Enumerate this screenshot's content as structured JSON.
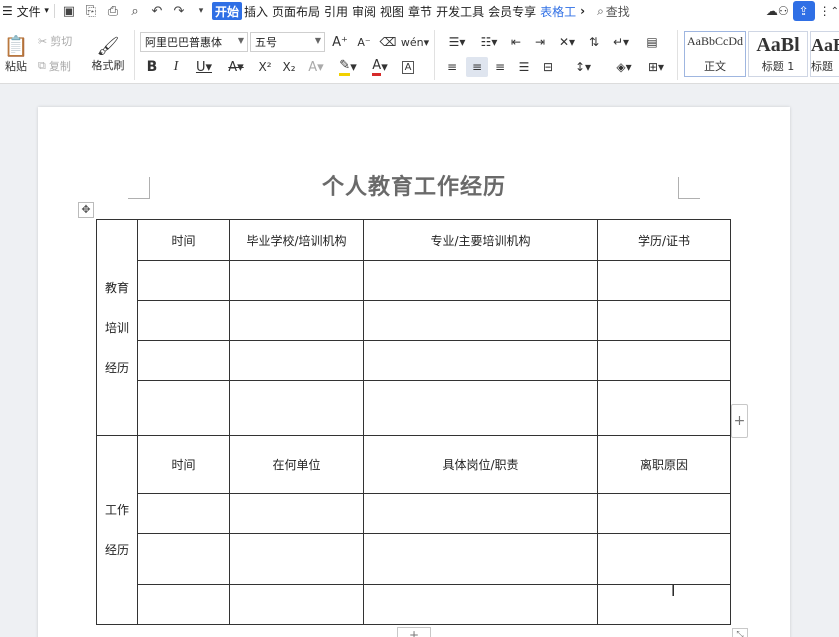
{
  "menubar": {
    "menu_label": "文件",
    "tabs": [
      "开始",
      "插入",
      "页面布局",
      "引用",
      "审阅",
      "视图",
      "章节",
      "开发工具",
      "会员专享",
      "表格工"
    ],
    "search_label": "查找",
    "more_tabs_glyph": "›"
  },
  "ribbon": {
    "paste_label": "粘贴",
    "cut_label": "剪切",
    "copy_label": "复制",
    "format_painter_label": "格式刷",
    "font_name": "阿里巴巴普惠体",
    "font_size": "五号",
    "styles": [
      {
        "preview": "AaBbCcDd",
        "label": "正文"
      },
      {
        "preview": "AaBl",
        "label": "标题 1"
      },
      {
        "preview": "AaBl",
        "label": "标题"
      }
    ]
  },
  "document": {
    "title": "个人教育工作经历",
    "education_side_label": [
      "教育",
      "培训",
      "经历"
    ],
    "education_headers": [
      "时间",
      "毕业学校/培训机构",
      "专业/主要培训机构",
      "学历/证书"
    ],
    "work_side_label": [
      "工作",
      "经历"
    ],
    "work_headers": [
      "时间",
      "在何单位",
      "具体岗位/职责",
      "离职原因"
    ]
  },
  "colors": {
    "accent": "#2f6fe5",
    "title_gray": "#6a6a6a",
    "canvas": "#eef0f3"
  }
}
